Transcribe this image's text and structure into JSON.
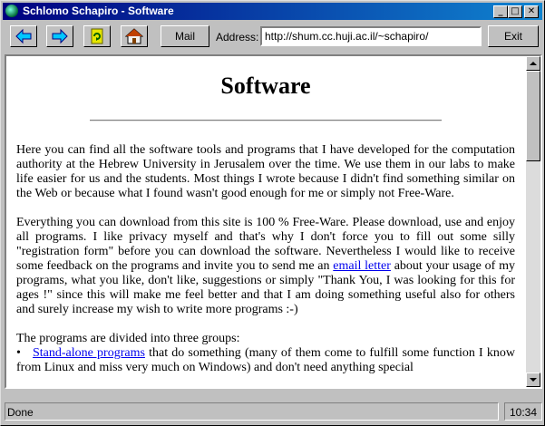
{
  "window": {
    "title": "Schlomo Schapiro - Software"
  },
  "title_buttons": {
    "minimize": "_",
    "maximize": "□",
    "close": "✕"
  },
  "toolbar": {
    "back_icon": "arrow-left-icon",
    "forward_icon": "arrow-right-icon",
    "reload_icon": "reload-icon",
    "home_icon": "home-icon",
    "mail_label": "Mail",
    "address_label": "Address:",
    "address_value": "http://shum.cc.huji.ac.il/~schapiro/",
    "exit_label": "Exit"
  },
  "page": {
    "heading": "Software",
    "para1": "Here you can find all the software tools and programs that I have developed for the computation authority at the Hebrew University in Jerusalem over the time. We use them in our labs to make life easier for us and the students. Most things I wrote because I didn't find something similar on the Web or because what I found wasn't good enough for me or simply not Free-Ware.",
    "para2_a": "Everything you can download from this site is 100 % Free-Ware. Please download, use and enjoy all programs. I like privacy myself and that's why I don't force you to fill out some silly \"registration form\" before you can download the software. Nevertheless I would like to receive some feedback on the programs and invite you to send me an ",
    "para2_link": "email letter",
    "para2_b": " about your usage of my programs, what you like, don't like, suggestions or simply \"Thank You, I was looking for this for ages !\" since this will make me feel better and that I am doing something useful also for others and surely increase my wish to write more programs :-)",
    "groups_intro": "The programs are divided into three groups:",
    "bullet": "•",
    "item1_link": "Stand-alone programs",
    "item1_text": " that do something (many of them come to fulfill some function I know from Linux and miss very much on Windows) and don't need anything special"
  },
  "status": {
    "text": "Done",
    "time": "10:34"
  },
  "colors": {
    "titlebar": "#000080",
    "link": "#0000ee",
    "chrome": "#c0c0c0"
  }
}
